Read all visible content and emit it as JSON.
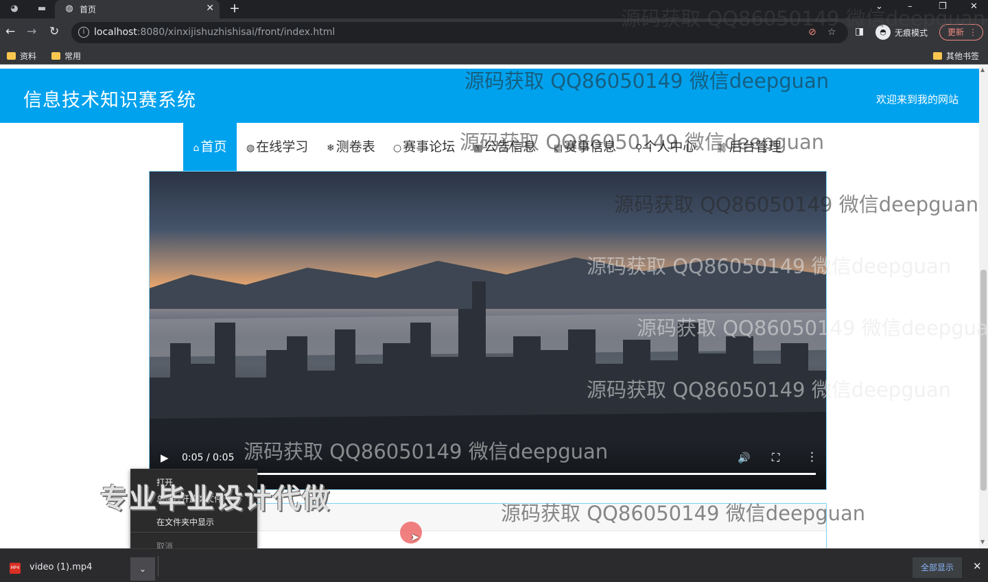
{
  "browser": {
    "tab_title": "首页",
    "url_host": "localhost",
    "url_rest": ":8080/xinxijishuzhishisai/front/index.html",
    "incognito_label": "无痕模式",
    "update_label": "更新",
    "bookmarks": [
      "资料",
      "常用"
    ],
    "other_bookmarks": "其他书签"
  },
  "site": {
    "title": "信息技术知识赛系统",
    "welcome": "欢迎来到我的网站",
    "nav": [
      {
        "icon": "⌂",
        "label": "首页"
      },
      {
        "icon": "◍",
        "label": "在线学习"
      },
      {
        "icon": "❄",
        "label": "测卷表"
      },
      {
        "icon": "○",
        "label": "赛事论坛"
      },
      {
        "icon": "▦",
        "label": "公告信息"
      },
      {
        "icon": "▤",
        "label": "赛事信息"
      },
      {
        "icon": "⚲",
        "label": "个人中心"
      },
      {
        "icon": "⛓",
        "label": "后台管理"
      }
    ]
  },
  "video": {
    "time": "0:05 / 0:05",
    "progress": 1.0
  },
  "context_menu": {
    "items": [
      "打开",
      "总是打开此类文件",
      "在文件夹中显示",
      "取消"
    ]
  },
  "download": {
    "file_name": "video (1).mp4",
    "show_all": "全部显示"
  },
  "watermark": {
    "text": "源码获取 QQ86050149 微信deepguan",
    "promo": "专业毕业设计代做"
  },
  "colors": {
    "brand": "#00a2ee",
    "chrome_dark": "#202124"
  }
}
